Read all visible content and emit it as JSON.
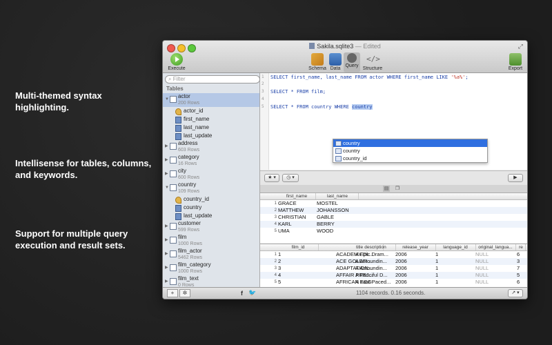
{
  "promo": {
    "line1": "Multi-themed syntax highlighting.",
    "line2": "Intellisense for tables, columns, and keywords.",
    "line3": "Support for multiple query execution and result sets."
  },
  "window": {
    "title": "Sakila.sqlite3",
    "edited": "— Edited"
  },
  "toolbar": {
    "execute": "Execute",
    "schema": "Schema",
    "data": "Data",
    "query": "Query",
    "structure": "Structure",
    "structure_glyph": "</>",
    "export": "Export"
  },
  "sidebar": {
    "filter_placeholder": "Filter",
    "heading": "Tables",
    "tables": [
      {
        "name": "actor",
        "count": "200 Rows",
        "expanded": true,
        "columns": [
          {
            "name": "actor_id",
            "key": true
          },
          {
            "name": "first_name"
          },
          {
            "name": "last_name"
          },
          {
            "name": "last_update"
          }
        ]
      },
      {
        "name": "address",
        "count": "603 Rows"
      },
      {
        "name": "category",
        "count": "16 Rows"
      },
      {
        "name": "city",
        "count": "600 Rows"
      },
      {
        "name": "country",
        "count": "109 Rows",
        "expanded": true,
        "columns": [
          {
            "name": "country_id",
            "key": true
          },
          {
            "name": "country"
          },
          {
            "name": "last_update"
          }
        ]
      },
      {
        "name": "customer",
        "count": "599 Rows"
      },
      {
        "name": "film",
        "count": "1000 Rows"
      },
      {
        "name": "film_actor",
        "count": "5462 Rows"
      },
      {
        "name": "film_category",
        "count": "1000 Rows"
      },
      {
        "name": "film_text",
        "count": "0 Rows"
      }
    ]
  },
  "editor": {
    "line_numbers": [
      "1",
      "2",
      "3",
      "4",
      "5"
    ],
    "line1_a": "SELECT first_name, last_name FROM actor WHERE first_name LIKE ",
    "line1_str": "'%a%'",
    "line1_b": ";",
    "line3": "SELECT * FROM film;",
    "line5_a": "SELECT * FROM country WHERE ",
    "line5_hl": "country",
    "autocomplete": [
      "country",
      "country",
      "country_id"
    ]
  },
  "query_toolbar": {
    "favorites": "★ ▾",
    "history": "◷ ▾",
    "run": "▶"
  },
  "result1": {
    "columns": [
      "first_name",
      "last_name"
    ],
    "rows": [
      [
        "1",
        "GRACE",
        "MOSTEL"
      ],
      [
        "2",
        "MATTHEW",
        "JOHANSSON"
      ],
      [
        "3",
        "CHRISTIAN",
        "GABLE"
      ],
      [
        "4",
        "KARL",
        "BERRY"
      ],
      [
        "5",
        "UMA",
        "WOOD"
      ]
    ]
  },
  "result2": {
    "columns": [
      "film_id",
      "title",
      "description",
      "release_year",
      "language_id",
      "original_langua...",
      "re"
    ],
    "rows": [
      [
        "1",
        "1",
        "ACADEMY DI...",
        "A Epic Dram...",
        "2006",
        "1",
        "NULL",
        "6"
      ],
      [
        "2",
        "2",
        "ACE GOLDFI...",
        "A Astoundin...",
        "2006",
        "1",
        "NULL",
        "3"
      ],
      [
        "3",
        "3",
        "ADAPTATION...",
        "A Astoundin...",
        "2006",
        "1",
        "NULL",
        "7"
      ],
      [
        "4",
        "4",
        "AFFAIR PREJ...",
        "A Fanciful D...",
        "2006",
        "1",
        "NULL",
        "5"
      ],
      [
        "5",
        "5",
        "AFRICAN EGG",
        "A Fast-Paced...",
        "2006",
        "1",
        "NULL",
        "6"
      ]
    ]
  },
  "status": {
    "add": "+",
    "gear": "✲",
    "facebook": "f",
    "twitter": "🐦",
    "text": "1104 records. 0.16 seconds.",
    "share": "↗ ▾"
  }
}
